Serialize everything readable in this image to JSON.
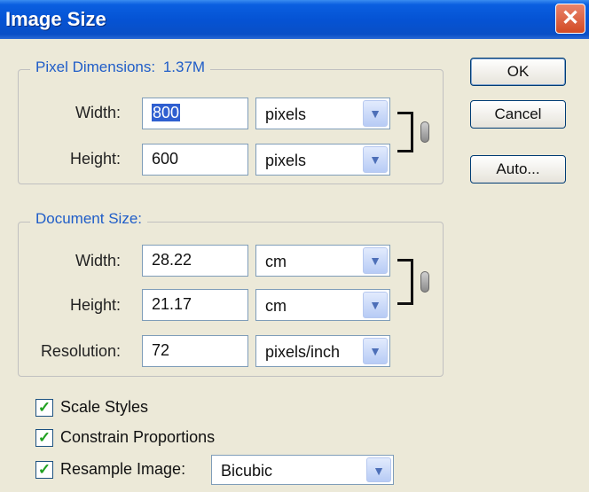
{
  "window": {
    "title": "Image Size",
    "close_label": "✕"
  },
  "pixel_dimensions": {
    "label": "Pixel Dimensions:",
    "size": "1.37M",
    "width": {
      "label": "Width:",
      "value": "800",
      "unit": "pixels"
    },
    "height": {
      "label": "Height:",
      "value": "600",
      "unit": "pixels"
    }
  },
  "document_size": {
    "label": "Document Size:",
    "width": {
      "label": "Width:",
      "value": "28.22",
      "unit": "cm"
    },
    "height": {
      "label": "Height:",
      "value": "21.17",
      "unit": "cm"
    },
    "resolution": {
      "label": "Resolution:",
      "value": "72",
      "unit": "pixels/inch"
    }
  },
  "buttons": {
    "ok": "OK",
    "cancel": "Cancel",
    "auto": "Auto..."
  },
  "options": {
    "scale_styles": {
      "label": "Scale Styles",
      "checked": true
    },
    "constrain_proportions": {
      "label": "Constrain Proportions",
      "checked": true
    },
    "resample_image": {
      "label": "Resample Image:",
      "checked": true,
      "method": "Bicubic"
    }
  },
  "icons": {
    "dropdown": "chevron-down-icon",
    "link": "chain-link-icon",
    "check": "checkmark-icon"
  },
  "colors": {
    "title_bar": "#0553d4",
    "group_label": "#1f5dc8",
    "dialog_bg": "#ece9d8",
    "close": "#d24a24"
  }
}
